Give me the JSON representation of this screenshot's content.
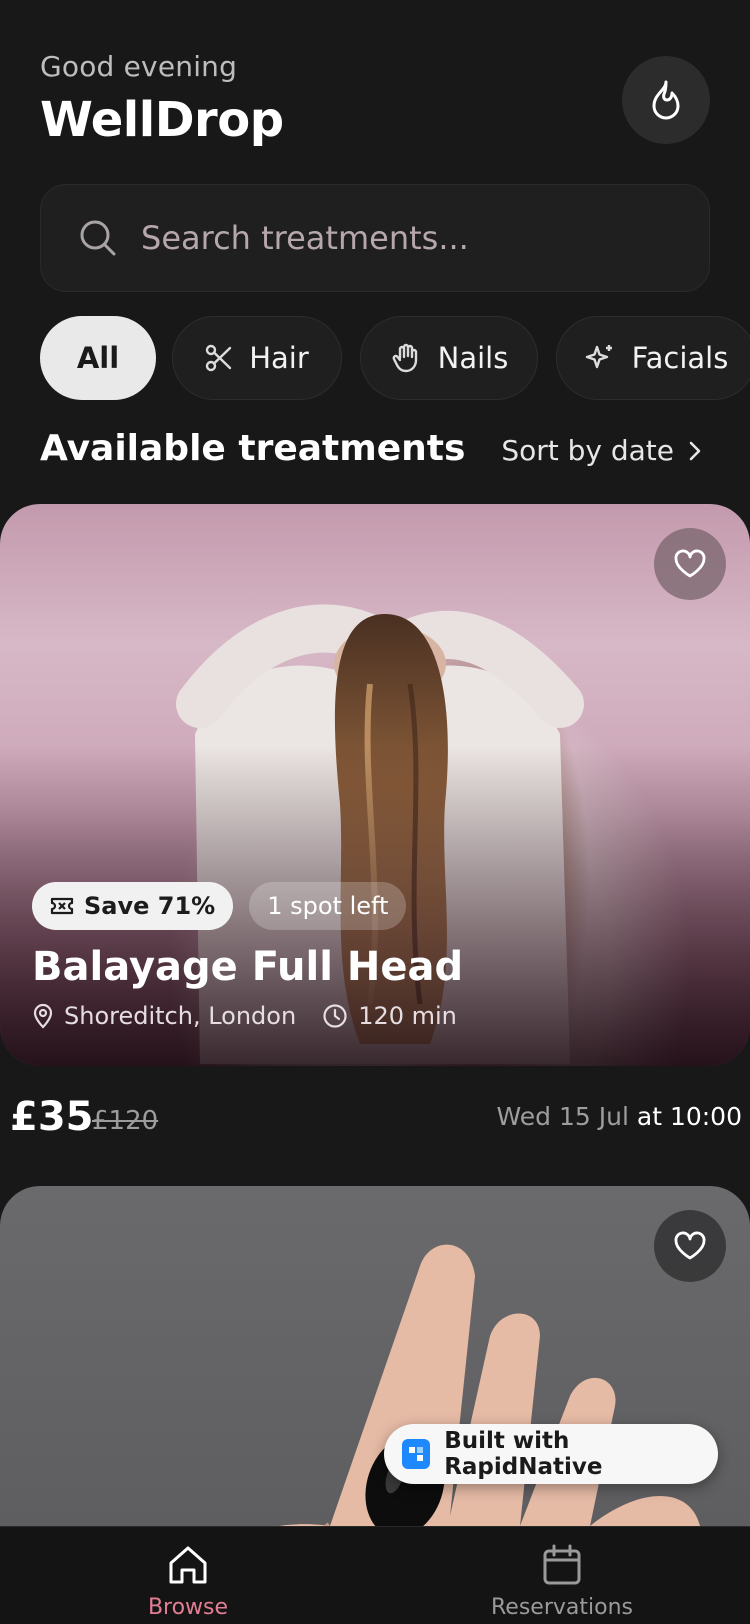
{
  "header": {
    "greeting": "Good evening",
    "brand": "WellDrop",
    "streak_icon": "flame-icon"
  },
  "search": {
    "placeholder": "Search treatments..."
  },
  "categories": [
    {
      "label": "All",
      "icon": "",
      "active": true
    },
    {
      "label": "Hair",
      "icon": "scissors-icon",
      "active": false
    },
    {
      "label": "Nails",
      "icon": "hand-icon",
      "active": false
    },
    {
      "label": "Facials",
      "icon": "sparkle-icon",
      "active": false
    }
  ],
  "section": {
    "title": "Available treatments",
    "sort_label": "Sort by date"
  },
  "cards": [
    {
      "save_label": "Save 71%",
      "spots_label": "1 spot left",
      "title": "Balayage Full Head",
      "location": "Shoreditch, London",
      "duration": "120 min",
      "price": "£35",
      "old_price": "£120",
      "date": "Wed 15 Jul",
      "time": "at 10:00"
    },
    {
      "image": "nails-photo"
    }
  ],
  "built_with": "Built with RapidNative",
  "tabs": {
    "browse": "Browse",
    "reservations": "Reservations"
  },
  "colors": {
    "accent": "#e37d93",
    "background": "#181818"
  }
}
